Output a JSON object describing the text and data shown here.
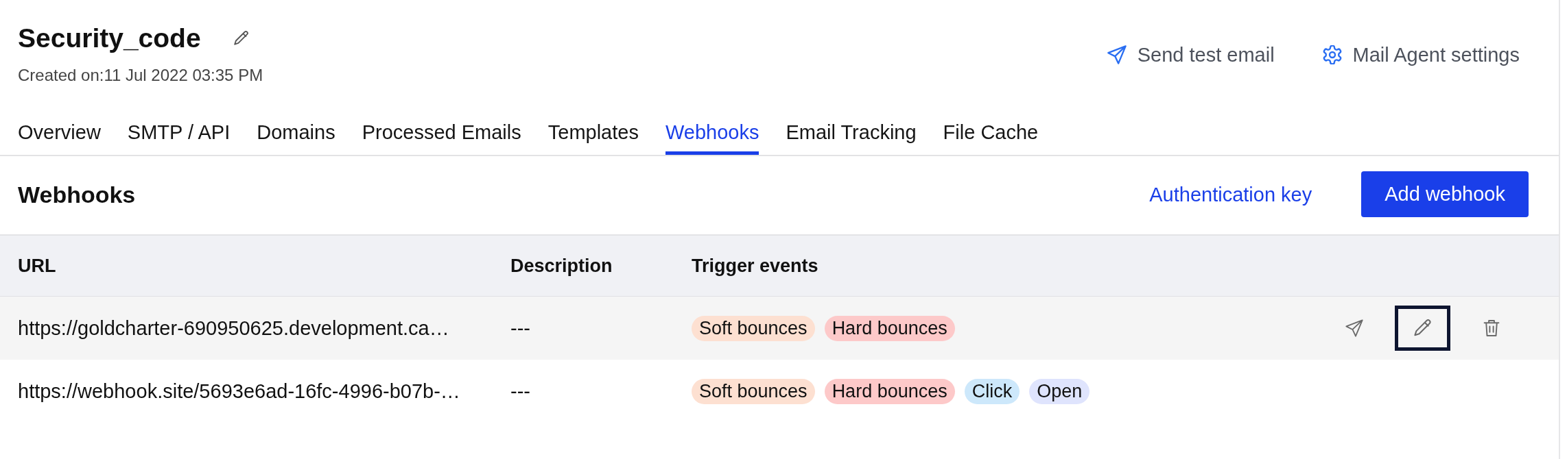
{
  "header": {
    "title": "Security_code",
    "created": "Created on:11 Jul 2022 03:35 PM",
    "actions": [
      {
        "kind": "send",
        "label": "Send test email"
      },
      {
        "kind": "settings",
        "label": "Mail Agent settings"
      }
    ]
  },
  "tabs": [
    {
      "label": "Overview",
      "selected": false
    },
    {
      "label": "SMTP / API",
      "selected": false
    },
    {
      "label": "Domains",
      "selected": false
    },
    {
      "label": "Processed Emails",
      "selected": false
    },
    {
      "label": "Templates",
      "selected": false
    },
    {
      "label": "Webhooks",
      "selected": true
    },
    {
      "label": "Email Tracking",
      "selected": false
    },
    {
      "label": "File Cache",
      "selected": false
    }
  ],
  "section": {
    "title": "Webhooks",
    "link": "Authentication key",
    "button": "Add webhook"
  },
  "table": {
    "columns": [
      "URL",
      "Description",
      "Trigger events"
    ],
    "row_actions": [
      {
        "kind": "send",
        "focused": false
      },
      {
        "kind": "edit",
        "focused": true
      },
      {
        "kind": "delete",
        "focused": false
      }
    ],
    "rows": [
      {
        "url": "https://goldcharter-690950625.development.ca…",
        "description": "---",
        "hovered": true,
        "events": [
          {
            "label": "Soft bounces",
            "color": "#fde0d1"
          },
          {
            "label": "Hard bounces",
            "color": "#fdc9c9"
          }
        ]
      },
      {
        "url": "https://webhook.site/5693e6ad-16fc-4996-b07b-…",
        "description": "---",
        "hovered": false,
        "events": [
          {
            "label": "Soft bounces",
            "color": "#fde0d1"
          },
          {
            "label": "Hard bounces",
            "color": "#fdc9c9"
          },
          {
            "label": "Click",
            "color": "#cde8fb"
          },
          {
            "label": "Open",
            "color": "#dfe4fd"
          }
        ]
      }
    ]
  }
}
